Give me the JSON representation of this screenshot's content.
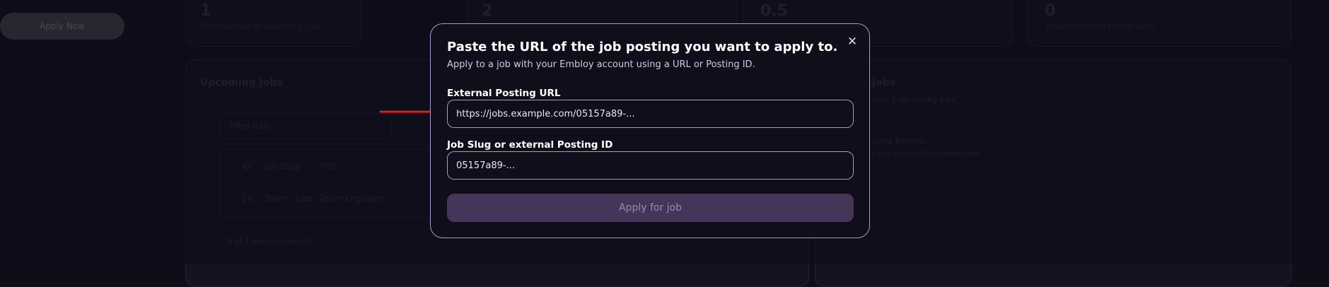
{
  "background": {
    "sidebar_button": "Apply Now",
    "stats": [
      {
        "value": "1",
        "caption": "Total number of upcoming jobs"
      },
      {
        "value": "2",
        "caption": ""
      },
      {
        "value": "0.5",
        "caption": ""
      },
      {
        "value": "0",
        "caption": "Total number of profile visits"
      }
    ],
    "upcoming_jobs_title": "Upcoming Jobs",
    "filter_placeholder": "Filter jobs...",
    "table_header": [
      "ID",
      "Job Slug",
      "Title"
    ],
    "table_row": [
      "16",
      "Team - Jobs",
      "Team Engineer"
    ],
    "selected_text": "0 of 1 row(s) selected.",
    "right_title": "Jobs",
    "right_sub": "Your 1 upcoming jobs",
    "right_name": "Carlo Bochsel",
    "right_email": "carlo.bochsel@hotmail.com"
  },
  "modal": {
    "title": "Paste the URL of the job posting you want to apply to.",
    "subtitle": "Apply to a job with your Embloy account using a URL or Posting ID.",
    "close_icon": "close-icon",
    "url_field": {
      "label": "External Posting URL",
      "value": "https://jobs.example.com/05157a89-..."
    },
    "slug_field": {
      "label": "Job Slug or external Posting ID",
      "value": "05157a89-..."
    },
    "apply_button": "Apply for job"
  },
  "colors": {
    "modal_border": "#a59bd4",
    "button_bg": "#443659",
    "button_text": "#938ba8",
    "arrow": "#e01b1b",
    "background": "#0e0d18"
  }
}
